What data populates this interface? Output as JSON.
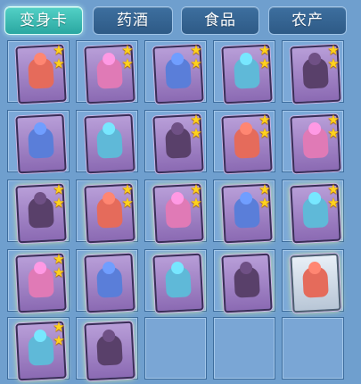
{
  "tabs": [
    {
      "label": "变身卡",
      "active": true
    },
    {
      "label": "药酒",
      "active": false
    },
    {
      "label": "食品",
      "active": false
    },
    {
      "label": "农产",
      "active": false
    }
  ],
  "items": [
    {
      "stars": 2,
      "icon": "fairy-transform-card"
    },
    {
      "stars": 2,
      "icon": "fox-transform-card"
    },
    {
      "stars": 2,
      "icon": "fire-beast-transform-card"
    },
    {
      "stars": 2,
      "icon": "monkey-transform-card"
    },
    {
      "stars": 2,
      "icon": "unicorn-transform-card"
    },
    {
      "stars": 0,
      "icon": "horse-knight-transform-card"
    },
    {
      "stars": 0,
      "icon": "horse-knight-transform-card"
    },
    {
      "stars": 2,
      "icon": "armored-warrior-transform-card"
    },
    {
      "stars": 2,
      "icon": "armored-warrior-transform-card"
    },
    {
      "stars": 2,
      "icon": "armored-warrior-transform-card"
    },
    {
      "stars": 2,
      "icon": "peacock-transform-card"
    },
    {
      "stars": 2,
      "icon": "bird-warrior-transform-card"
    },
    {
      "stars": 2,
      "icon": "blade-master-transform-card"
    },
    {
      "stars": 2,
      "icon": "swordsman-transform-card"
    },
    {
      "stars": 2,
      "icon": "swordsman-transform-card"
    },
    {
      "stars": 2,
      "icon": "lion-dancer-transform-card"
    },
    {
      "stars": 0,
      "icon": "spirit-transform-card"
    },
    {
      "stars": 0,
      "icon": "winged-girl-transform-card"
    },
    {
      "stars": 0,
      "icon": "panda-transform-card"
    },
    {
      "stars": 0,
      "icon": "ghost-knight-transform-card"
    },
    {
      "stars": 2,
      "icon": "dragon-knight-transform-card"
    },
    {
      "stars": 0,
      "icon": "fox-spirit-transform-card"
    },
    {
      "stars": 0,
      "icon": "empty-slot"
    },
    {
      "stars": 0,
      "icon": "empty-slot"
    },
    {
      "stars": 0,
      "icon": "empty-slot"
    }
  ],
  "colors": {
    "active_tab": "#2aa7a1",
    "tab": "#2e5a86",
    "slot": "#7ca9d8",
    "card": "#8b6ab3",
    "star": "#ffd21c"
  }
}
